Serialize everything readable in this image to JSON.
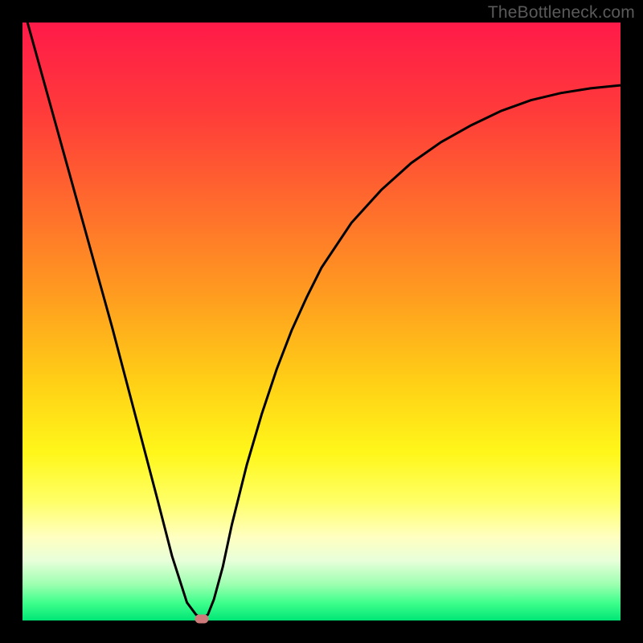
{
  "watermark": "TheBottleneck.com",
  "chart_data": {
    "type": "line",
    "title": "",
    "xlabel": "",
    "ylabel": "",
    "xlim": [
      0,
      1
    ],
    "ylim": [
      0,
      1
    ],
    "legend": false,
    "grid": false,
    "background": {
      "type": "vertical_gradient",
      "stops": [
        {
          "pos": 0.0,
          "color": "#ff1a49"
        },
        {
          "pos": 0.15,
          "color": "#ff3b3a"
        },
        {
          "pos": 0.3,
          "color": "#ff6a2d"
        },
        {
          "pos": 0.45,
          "color": "#ff9a20"
        },
        {
          "pos": 0.6,
          "color": "#ffcf16"
        },
        {
          "pos": 0.72,
          "color": "#fff71a"
        },
        {
          "pos": 0.8,
          "color": "#ffff66"
        },
        {
          "pos": 0.86,
          "color": "#ffffc0"
        },
        {
          "pos": 0.9,
          "color": "#e8ffda"
        },
        {
          "pos": 0.94,
          "color": "#9cffb0"
        },
        {
          "pos": 0.97,
          "color": "#3fff8c"
        },
        {
          "pos": 1.0,
          "color": "#00e676"
        }
      ]
    },
    "series": [
      {
        "name": "bottleneck_curve",
        "color": "#000000",
        "stroke_width": 3,
        "x": [
          0.0,
          0.025,
          0.05,
          0.075,
          0.1,
          0.125,
          0.15,
          0.175,
          0.2,
          0.225,
          0.25,
          0.275,
          0.29,
          0.3,
          0.31,
          0.32,
          0.335,
          0.35,
          0.375,
          0.4,
          0.425,
          0.45,
          0.475,
          0.5,
          0.55,
          0.6,
          0.65,
          0.7,
          0.75,
          0.8,
          0.85,
          0.9,
          0.95,
          1.0
        ],
        "y": [
          1.03,
          0.94,
          0.85,
          0.76,
          0.67,
          0.58,
          0.49,
          0.395,
          0.3,
          0.205,
          0.108,
          0.03,
          0.01,
          0.003,
          0.01,
          0.035,
          0.09,
          0.16,
          0.26,
          0.345,
          0.42,
          0.485,
          0.54,
          0.59,
          0.665,
          0.72,
          0.765,
          0.8,
          0.828,
          0.852,
          0.87,
          0.882,
          0.89,
          0.895
        ]
      }
    ],
    "markers": [
      {
        "name": "optimal_point",
        "x": 0.3,
        "y": 0.003,
        "color": "#cf7a7a",
        "shape": "rounded_rect"
      }
    ]
  }
}
